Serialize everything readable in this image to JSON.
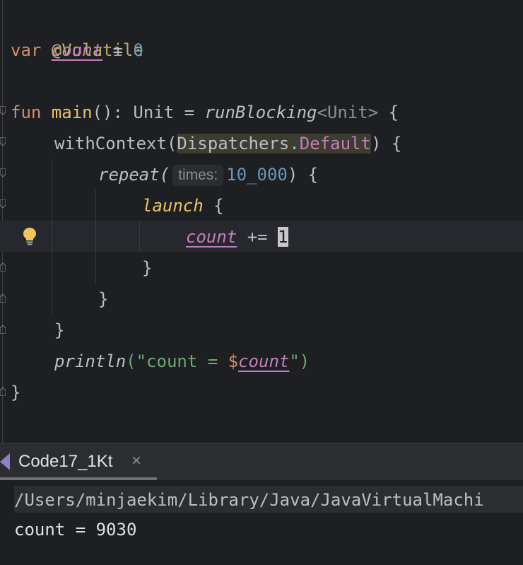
{
  "editor": {
    "line1": {
      "annotation": "@Volatile"
    },
    "line2": {
      "kw_var": "var",
      "prop": "count",
      "eq": " = ",
      "num": "0"
    },
    "line4": {
      "kw_fun": "fun",
      "name": " main",
      "sig": "(): Unit = ",
      "builder": "runBlocking",
      "generic": "<Unit>",
      "brace": " {"
    },
    "line5": {
      "call": "withContext(",
      "dispatchers": "Dispatchers.",
      "default": "Default",
      "close": ") {"
    },
    "line6": {
      "call": "repeat(",
      "hint": "times:",
      "num": "10_000",
      "close": ") {"
    },
    "line7": {
      "call": "launch",
      "brace": " {"
    },
    "line8": {
      "prop": "count",
      "op": " += ",
      "num": "1"
    },
    "line9": {
      "brace": "}"
    },
    "line10": {
      "brace": "}"
    },
    "line11": {
      "brace": "}"
    },
    "line12": {
      "call": "println",
      "open": "(\"count = ",
      "dollar": "$",
      "prop": "count",
      "close": "\")"
    },
    "line13": {
      "brace": "}"
    }
  },
  "tool_window": {
    "tab_label": "Code17_1Kt",
    "close_glyph": "×",
    "console_path": "/Users/minjaekim/Library/Java/JavaVirtualMachi",
    "console_output": "count = 9030"
  },
  "colors": {
    "background": "#1e1f22",
    "keyword": "#cf8e6d",
    "annotation": "#b3ae60",
    "property": "#c77dbb",
    "number": "#6897bb"
  }
}
